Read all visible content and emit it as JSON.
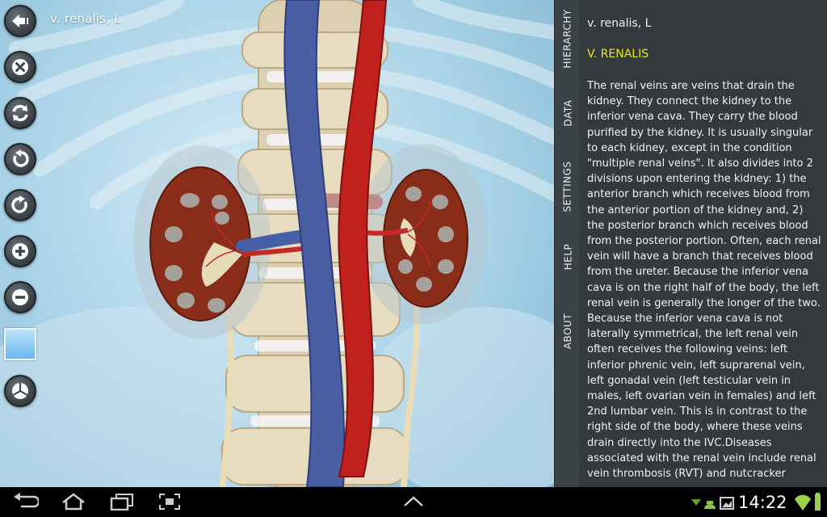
{
  "viewer": {
    "selection_label": "v. renalis, L"
  },
  "toolbar": {
    "buttons": [
      {
        "name": "back",
        "icon": "back-arrow-icon"
      },
      {
        "name": "close",
        "icon": "close-icon"
      },
      {
        "name": "reset-view",
        "icon": "refresh-icon"
      },
      {
        "name": "rotate-left",
        "icon": "rotate-left-icon"
      },
      {
        "name": "rotate-right",
        "icon": "rotate-right-icon"
      },
      {
        "name": "zoom-in",
        "icon": "zoom-in-icon"
      },
      {
        "name": "zoom-out",
        "icon": "zoom-out-icon"
      },
      {
        "name": "background-color",
        "icon": "color-swatch"
      },
      {
        "name": "layers",
        "icon": "pie-icon"
      }
    ],
    "swatch_color": "#8ccbf3"
  },
  "panel_tabs": [
    "HIERARCHY",
    "DATA",
    "SETTINGS",
    "HELP",
    "ABOUT"
  ],
  "info_panel": {
    "breadcrumb": "v. renalis, L",
    "heading": "V. RENALIS",
    "body": "The renal veins are veins that drain the kidney. They connect the kidney to the inferior vena cava. They carry the blood purified by the kidney. It is usually singular to each kidney, except in the condition \"multiple renal veins\". It also divides into 2 divisions upon entering the kidney: 1) the anterior branch which receives blood from the anterior portion of the kidney and, 2) the posterior branch which receives blood from the posterior portion. Often, each renal vein will have a branch that receives blood from the ureter. Because the inferior vena cava is on the right half of the body, the left renal vein is generally the longer of the two. Because the inferior vena cava is not laterally symmetrical, the left renal vein often receives the following veins: left inferior phrenic vein, left suprarenal vein, left gonadal vein (left testicular vein in males, left ovarian vein in females) and left 2nd lumbar vein. This is in contrast to the right side of the body, where these veins drain directly into the IVC.Diseases associated with the renal vein include renal vein thrombosis (RVT) and nutcracker",
    "heading_color": "#e9e82a"
  },
  "system_bar": {
    "time": "14:22"
  }
}
